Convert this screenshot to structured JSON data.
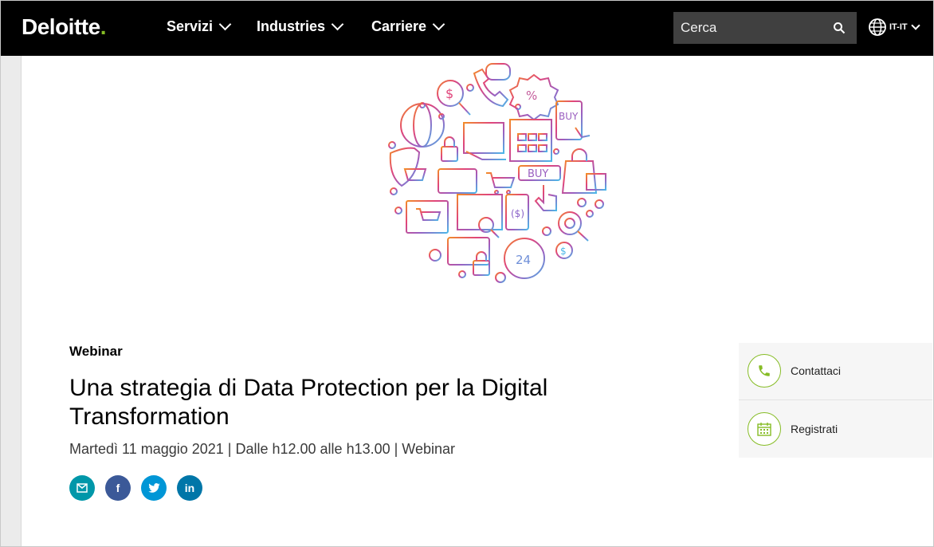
{
  "header": {
    "logo": "Deloitte",
    "logo_dot": ".",
    "nav": [
      {
        "label": "Servizi"
      },
      {
        "label": "Industries"
      },
      {
        "label": "Carriere"
      }
    ],
    "search_placeholder": "Cerca",
    "language": "IT-IT"
  },
  "article": {
    "eyebrow": "Webinar",
    "title": "Una strategia di Data Protection per la Digital Transformation",
    "meta": "Martedì 11 maggio 2021 | Dalle h12.00 alle h13.00 | Webinar"
  },
  "share": {
    "email_icon": "envelope-icon",
    "facebook_label": "f",
    "linkedin_label": "in"
  },
  "sidebar": {
    "contact_label": "Contattaci",
    "register_label": "Registrati"
  },
  "colors": {
    "brand_green": "#86bc25",
    "header_bg": "#000000",
    "email": "#0097a9",
    "facebook": "#3b5998",
    "twitter": "#0096d6",
    "linkedin": "#0076a8"
  }
}
